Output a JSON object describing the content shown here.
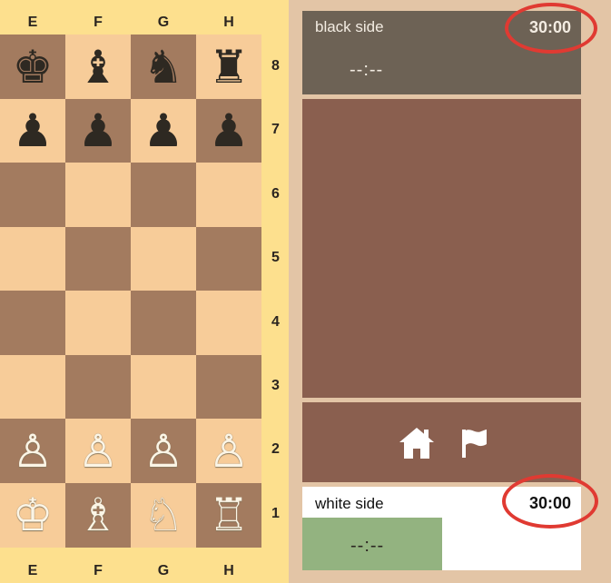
{
  "board": {
    "files": [
      "E",
      "F",
      "G",
      "H"
    ],
    "ranks": [
      "8",
      "7",
      "6",
      "5",
      "4",
      "3",
      "2",
      "1"
    ],
    "rows": [
      [
        {
          "piece": "♚",
          "side": "black"
        },
        {
          "piece": "♝",
          "side": "black"
        },
        {
          "piece": "♞",
          "side": "black"
        },
        {
          "piece": "♜",
          "side": "black"
        }
      ],
      [
        {
          "piece": "♟",
          "side": "black"
        },
        {
          "piece": "♟",
          "side": "black"
        },
        {
          "piece": "♟",
          "side": "black"
        },
        {
          "piece": "♟",
          "side": "black"
        }
      ],
      [
        {
          "piece": "",
          "side": ""
        },
        {
          "piece": "",
          "side": ""
        },
        {
          "piece": "",
          "side": ""
        },
        {
          "piece": "",
          "side": ""
        }
      ],
      [
        {
          "piece": "",
          "side": ""
        },
        {
          "piece": "",
          "side": ""
        },
        {
          "piece": "",
          "side": ""
        },
        {
          "piece": "",
          "side": ""
        }
      ],
      [
        {
          "piece": "",
          "side": ""
        },
        {
          "piece": "",
          "side": ""
        },
        {
          "piece": "",
          "side": ""
        },
        {
          "piece": "",
          "side": ""
        }
      ],
      [
        {
          "piece": "",
          "side": ""
        },
        {
          "piece": "",
          "side": ""
        },
        {
          "piece": "",
          "side": ""
        },
        {
          "piece": "",
          "side": ""
        }
      ],
      [
        {
          "piece": "♙",
          "side": "white"
        },
        {
          "piece": "♙",
          "side": "white"
        },
        {
          "piece": "♙",
          "side": "white"
        },
        {
          "piece": "♙",
          "side": "white"
        }
      ],
      [
        {
          "piece": "♔",
          "side": "white"
        },
        {
          "piece": "♗",
          "side": "white"
        },
        {
          "piece": "♘",
          "side": "white"
        },
        {
          "piece": "♖",
          "side": "white"
        }
      ]
    ]
  },
  "black_player": {
    "label": "black side",
    "time": "30:00",
    "move_clock": "--:--"
  },
  "white_player": {
    "label": "white side",
    "time": "30:00",
    "move_clock": "--:--"
  },
  "controls": {
    "home_icon": "home-icon",
    "flag_icon": "flag-icon"
  },
  "colors": {
    "light_square": "#f7cc99",
    "dark_square": "#a37b5f",
    "board_frame": "#fde08e",
    "panel_brown": "#8a5f4f",
    "black_panel": "#6d6255",
    "white_clock_active": "#93b380",
    "annotation": "#e03a32"
  }
}
